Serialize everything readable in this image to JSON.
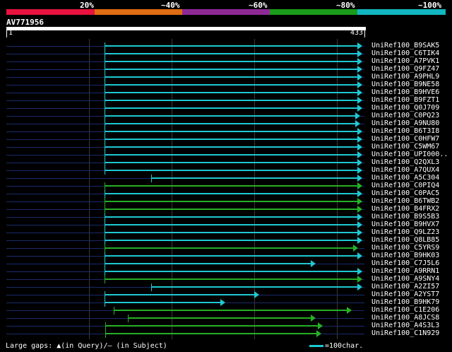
{
  "scale": {
    "labels": [
      "20%",
      "~40%",
      "~60%",
      "~80%",
      "~100%"
    ],
    "colors": [
      "#e8123e",
      "#e06c14",
      "#8e2a96",
      "#1a9b1a",
      "#12b6c2"
    ]
  },
  "query": {
    "id": "AV771956",
    "start": "1",
    "end": "433",
    "length": 433
  },
  "hits": [
    {
      "name": "UniRef100_B9SAK5",
      "start": 120,
      "end": 433,
      "color": "cyan"
    },
    {
      "name": "UniRef100_C6TIK4",
      "start": 120,
      "end": 433,
      "color": "cyan"
    },
    {
      "name": "UniRef100_A7PVK1",
      "start": 120,
      "end": 433,
      "color": "cyan"
    },
    {
      "name": "UniRef100_Q9FZ47",
      "start": 120,
      "end": 433,
      "color": "cyan"
    },
    {
      "name": "UniRef100_A9PHL9",
      "start": 120,
      "end": 433,
      "color": "cyan"
    },
    {
      "name": "UniRef100_B9NE58",
      "start": 120,
      "end": 433,
      "color": "cyan"
    },
    {
      "name": "UniRef100_B9HVE6",
      "start": 120,
      "end": 433,
      "color": "cyan"
    },
    {
      "name": "UniRef100_B9FZT1",
      "start": 120,
      "end": 433,
      "color": "cyan"
    },
    {
      "name": "UniRef100_Q0J709",
      "start": 120,
      "end": 433,
      "color": "cyan"
    },
    {
      "name": "UniRef100_C0PQ23",
      "start": 120,
      "end": 430,
      "color": "cyan"
    },
    {
      "name": "UniRef100_A9NU80",
      "start": 120,
      "end": 430,
      "color": "cyan"
    },
    {
      "name": "UniRef100_B6T3I8",
      "start": 120,
      "end": 433,
      "color": "cyan"
    },
    {
      "name": "UniRef100_C0HFW7",
      "start": 120,
      "end": 433,
      "color": "cyan"
    },
    {
      "name": "UniRef100_C5WM67",
      "start": 120,
      "end": 433,
      "color": "cyan"
    },
    {
      "name": "UniRef100_UPI000..",
      "start": 120,
      "end": 433,
      "color": "cyan"
    },
    {
      "name": "UniRef100_Q2QXL3",
      "start": 120,
      "end": 433,
      "color": "cyan"
    },
    {
      "name": "UniRef100_A7QUX4",
      "start": 120,
      "end": 433,
      "color": "cyan"
    },
    {
      "name": "UniRef100_A5C304",
      "start": 177,
      "end": 433,
      "color": "cyan"
    },
    {
      "name": "UniRef100_C0PIQ4",
      "start": 120,
      "end": 433,
      "color": "green"
    },
    {
      "name": "UniRef100_C0PAC5",
      "start": 120,
      "end": 433,
      "color": "cyan"
    },
    {
      "name": "UniRef100_B6TWB2",
      "start": 120,
      "end": 433,
      "color": "green"
    },
    {
      "name": "UniRef100_B4FRX2",
      "start": 120,
      "end": 433,
      "color": "green"
    },
    {
      "name": "UniRef100_B9S5B3",
      "start": 120,
      "end": 433,
      "color": "cyan"
    },
    {
      "name": "UniRef100_B9HVX7",
      "start": 120,
      "end": 433,
      "color": "cyan"
    },
    {
      "name": "UniRef100_Q9LZ23",
      "start": 120,
      "end": 433,
      "color": "cyan"
    },
    {
      "name": "UniRef100_Q8LB85",
      "start": 120,
      "end": 433,
      "color": "cyan"
    },
    {
      "name": "UniRef100_C5YRS9",
      "start": 120,
      "end": 428,
      "color": "green"
    },
    {
      "name": "UniRef100_B9HK03",
      "start": 120,
      "end": 433,
      "color": "cyan"
    },
    {
      "name": "UniRef100_C7J5L6",
      "start": 120,
      "end": 376,
      "color": "cyan"
    },
    {
      "name": "UniRef100_A9RRN1",
      "start": 120,
      "end": 433,
      "color": "cyan"
    },
    {
      "name": "UniRef100_A9SNY4",
      "start": 120,
      "end": 433,
      "color": "green"
    },
    {
      "name": "UniRef100_A2ZI57",
      "start": 177,
      "end": 433,
      "color": "cyan"
    },
    {
      "name": "UniRef100_A2YST7",
      "start": 120,
      "end": 308,
      "color": "cyan"
    },
    {
      "name": "UniRef100_B9HK79",
      "start": 120,
      "end": 267,
      "color": "cyan"
    },
    {
      "name": "UniRef100_C1E206",
      "start": 131,
      "end": 420,
      "color": "green"
    },
    {
      "name": "UniRef100_A8JCS8",
      "start": 148,
      "end": 376,
      "color": "green"
    },
    {
      "name": "UniRef100_A4S3L3",
      "start": 121,
      "end": 385,
      "color": "green"
    },
    {
      "name": "UniRef100_C1N929",
      "start": 121,
      "end": 383,
      "color": "green"
    }
  ],
  "footer": {
    "gaps_text": "Large gaps: ▲(in Query)/— (in Subject)",
    "legend_text": "=100char."
  }
}
